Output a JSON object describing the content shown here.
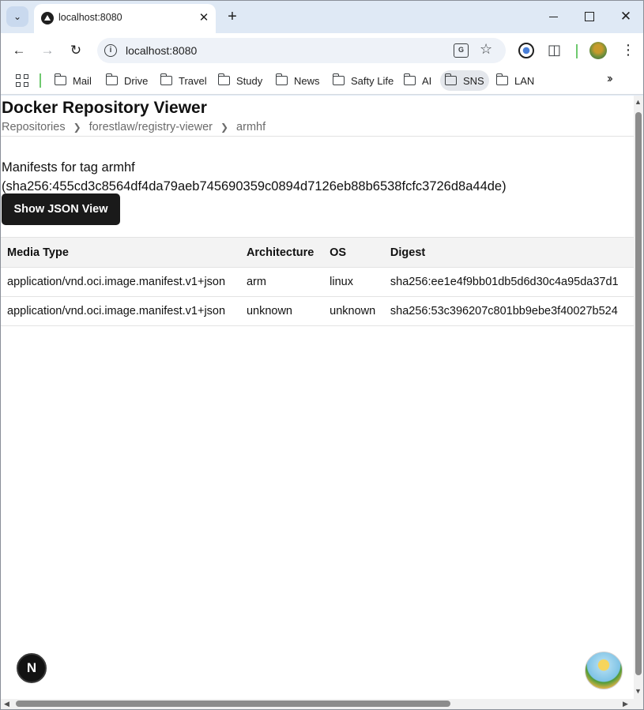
{
  "browser": {
    "tab_title": "localhost:8080",
    "url": "localhost:8080",
    "new_tab_symbol": "+",
    "close_symbol": "✕",
    "bookmarks": [
      {
        "label": "Mail"
      },
      {
        "label": "Drive"
      },
      {
        "label": "Travel"
      },
      {
        "label": "Study"
      },
      {
        "label": "News"
      },
      {
        "label": "Safty Life"
      },
      {
        "label": "AI"
      },
      {
        "label": "SNS"
      },
      {
        "label": "LAN"
      }
    ]
  },
  "page": {
    "title": "Docker Repository Viewer",
    "breadcrumb": {
      "root": "Repositories",
      "repo": "forestlaw/registry-viewer",
      "tag": "armhf"
    },
    "manifest_heading_line1": "Manifests for tag armhf",
    "manifest_heading_line2": "(sha256:455cd3c8564df4da79aeb745690359c0894d7126eb88b6538fcfc3726d8a44de)",
    "json_button_label": "Show JSON View",
    "table": {
      "headers": [
        "Media Type",
        "Architecture",
        "OS",
        "Digest"
      ],
      "rows": [
        [
          "application/vnd.oci.image.manifest.v1+json",
          "arm",
          "linux",
          "sha256:ee1e4f9bb01db5d6d30c4a95da37d1"
        ],
        [
          "application/vnd.oci.image.manifest.v1+json",
          "unknown",
          "unknown",
          "sha256:53c396207c801bb9ebe3f40027b524"
        ]
      ]
    },
    "floating_badge": "N"
  },
  "colors": {
    "button_bg": "#1a1a1a",
    "header_bg": "#f3f3f3",
    "frame_bg": "#dfe9f5"
  }
}
